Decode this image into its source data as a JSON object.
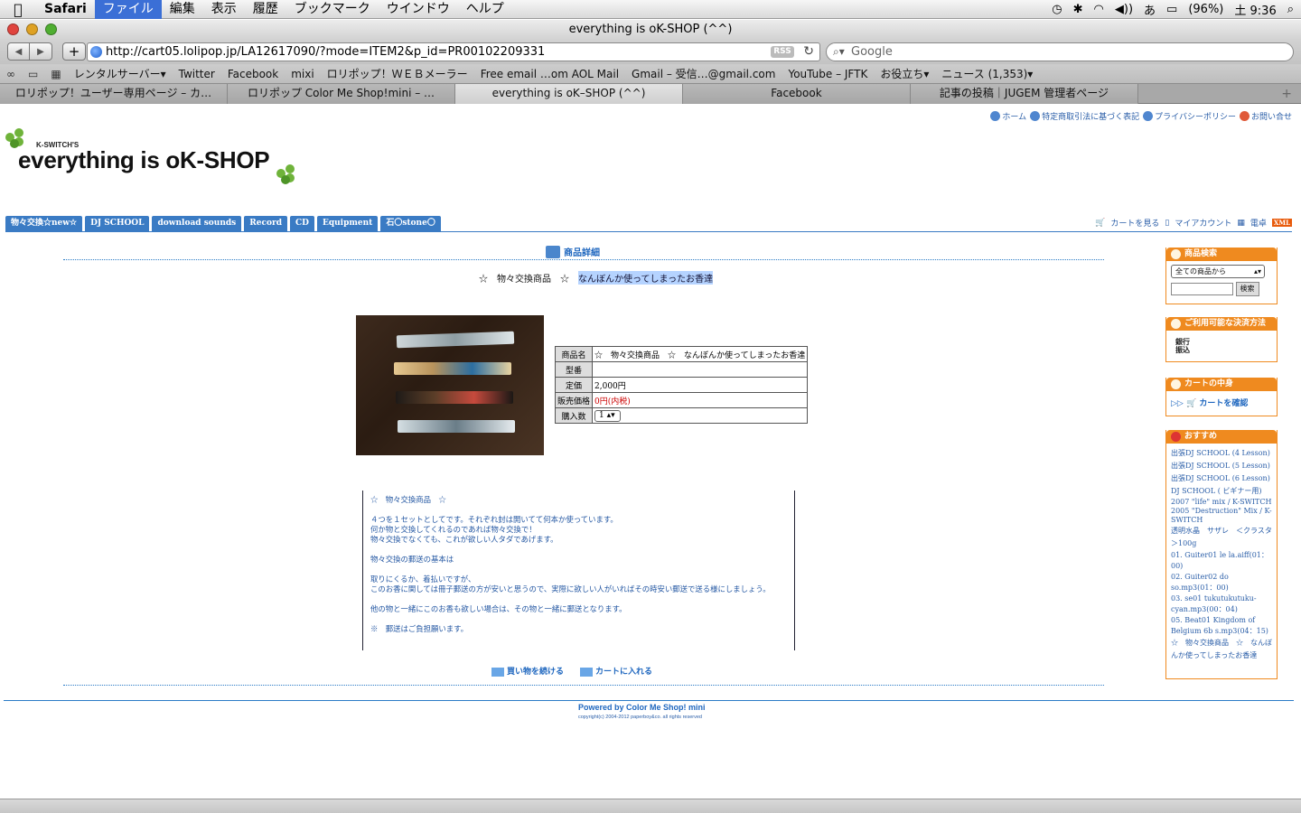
{
  "menubar": {
    "app": "Safari",
    "items": [
      "ファイル",
      "編集",
      "表示",
      "履歴",
      "ブックマーク",
      "ウインドウ",
      "ヘルプ"
    ],
    "battery": "(96%)",
    "clock": "土 9:36",
    "ime": "あ"
  },
  "window": {
    "title": "everything is oK-SHOP (^^)"
  },
  "toolbar": {
    "url": "http://cart05.lolipop.jp/LA12617090/?mode=ITEM2&p_id=PR00102209331",
    "rss": "RSS",
    "search_placeholder": "Google"
  },
  "bookmarks": [
    "レンタルサーバー▾",
    "Twitter",
    "Facebook",
    "mixi",
    "ロリポップ！ＷＥＢメーラー",
    "Free email …om AOL Mail",
    "Gmail – 受信…@gmail.com",
    "YouTube – JFTK",
    "お役立ち▾",
    "ニュース (1,353)▾"
  ],
  "tabs": [
    "ロリポップ！ユーザー専用ページ – カ…",
    "ロリポップ Color Me Shop!mini – …",
    "everything is oK–SHOP (^^)",
    "Facebook",
    "記事の投稿｜JUGEM 管理者ページ"
  ],
  "shop": {
    "logo_small": "K-SWITCH'S",
    "logo_big": "everything is oK-SHOP",
    "top_links": [
      "ホーム",
      "特定商取引法に基づく表記",
      "プライバシーポリシー",
      "お問い合せ"
    ],
    "nav": [
      "物々交換☆new☆",
      "DJ SCHOOL",
      "download sounds",
      "Record",
      "CD",
      "Equipment",
      "石〇stone〇"
    ],
    "right_nav": [
      "カートを見る",
      "マイアカウント",
      "電卓"
    ],
    "xml": "XML",
    "heading": "商品詳細",
    "title_prefix": "☆　物々交換商品　☆",
    "title_highlight": "なんぼんか使ってしまったお香達",
    "spec": {
      "name_label": "商品名",
      "name_value": "☆　物々交換商品　☆　なんぼんか使ってしまったお香達",
      "model_label": "型番",
      "model_value": "",
      "price_label": "定価",
      "price_value": "2,000円",
      "sale_label": "販売価格",
      "sale_value": "0円(内税)",
      "qty_label": "購入数",
      "qty_value": "1"
    },
    "description": [
      "☆　物々交換商品　☆",
      "４つを１セットとしてです。それぞれ封は開いてて何本か使っています。\n何か物と交換してくれるのであれば物々交換で！\n物々交換でなくても、これが欲しい人タダであげます。",
      "物々交換の郵送の基本は",
      "取りにくるか、着払いですが、\nこのお香に関しては冊子郵送の方が安いと思うので、実際に欲しい人がいればその時安い郵送で送る様にしましょう。",
      "他の物と一緒にこのお香も欲しい場合は、その物と一緒に郵送となります。",
      "※　郵送はご負担願います。"
    ],
    "btn_continue": "買い物を続ける",
    "btn_cart": "カートに入れる",
    "powered": "Powered by Color Me Shop! mini",
    "copyright": "copyright(c) 2004-2012 paperboy&co. all rights reserved"
  },
  "sidebar": {
    "search_title": "商品検索",
    "search_select": "全ての商品から",
    "search_button": "検索",
    "payment_title": "ご利用可能な決済方法",
    "payment_line1": "銀行",
    "payment_line2": "振込",
    "cart_title": "カートの中身",
    "cart_button": "カートを確認",
    "rec_title": "おすすめ",
    "rec_items": [
      "出張DJ SCHOOL (4 Lesson)",
      "出張DJ SCHOOL (5 Lesson)",
      "出張DJ SCHOOL (6 Lesson)",
      "DJ SCHOOL ( ビギナー用)",
      "2007 \"life\" mix / K-SWITCH",
      "2005 \"Destruction\" Mix / K-SWITCH",
      "透明水晶　サザレ　＜クラスタ＞100g",
      "01. Guiter01 le la.aiff(01：00)",
      "02. Guiter02 do so.mp3(01：00)",
      "03. se01 tukutukutuku-cyan.mp3(00：04)",
      "05. Beat01 Kingdom of Belgium 6b s.mp3(04：15)",
      "☆　物々交換商品　☆　なんぼんか使ってしまったお香達"
    ]
  }
}
